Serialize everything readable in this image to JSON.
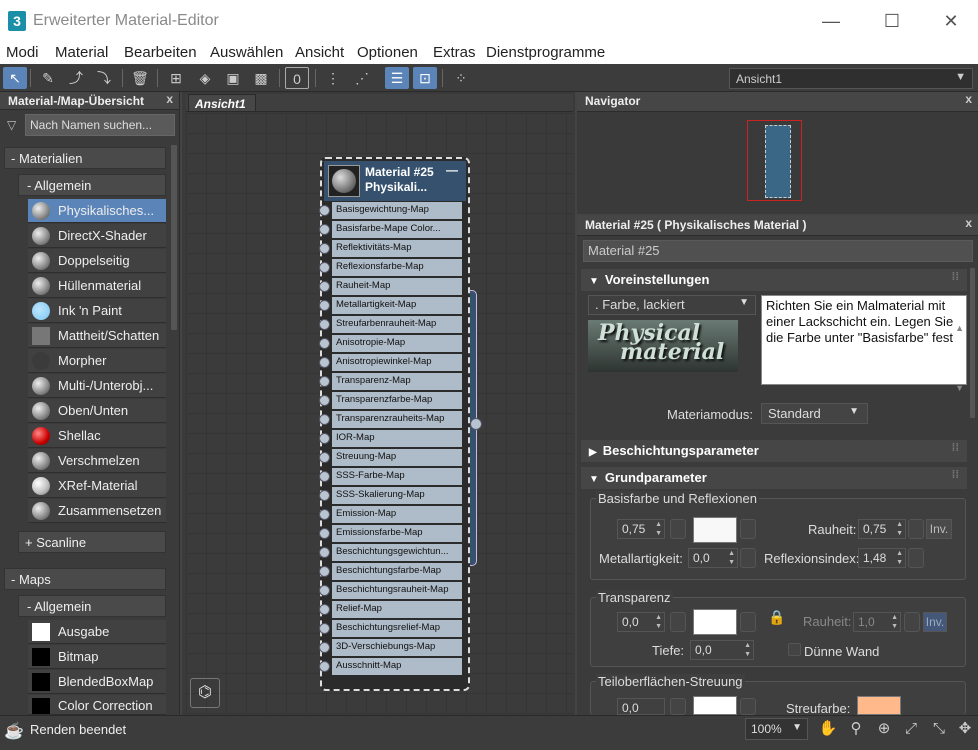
{
  "window": {
    "title": "Erweiterter Material-Editor",
    "app_icon": "3"
  },
  "menu": [
    "Modi",
    "Material",
    "Bearbeiten",
    "Auswählen",
    "Ansicht",
    "Optionen",
    "Extras",
    "Dienstprogramme"
  ],
  "toolbar": {
    "view_select": "Ansicht1",
    "zero_label": "0"
  },
  "left_panel": {
    "title": "Material-/Map-Übersicht",
    "search_placeholder": "Nach Namen suchen...",
    "materials_cat": "- Materialien",
    "general_sub": "- Allgemein",
    "items": [
      "Physikalisches...",
      "DirectX-Shader",
      "Doppelseitig",
      "Hüllenmaterial",
      "Ink 'n Paint",
      "Mattheit/Schatten",
      "Morpher",
      "Multi-/Unterobj...",
      "Oben/Unten",
      "Shellac",
      "Verschmelzen",
      "XRef-Material",
      "Zusammensetzen"
    ],
    "scanline": "+ Scanline",
    "maps_cat": "- Maps",
    "maps_general": "- Allgemein",
    "map_items": [
      "Ausgabe",
      "Bitmap",
      "BlendedBoxMap",
      "Color Correction"
    ]
  },
  "view_tab": "Ansicht1",
  "node": {
    "title_line1": "Material #25",
    "title_line2": "Physikali...",
    "slots": [
      "Basisgewichtung-Map",
      "Basisfarbe-Mape Color...",
      "Reflektivitäts-Map",
      "Reflexionsfarbe-Map",
      "Rauheit-Map",
      "Metallartigkeit-Map",
      "Streufarbenrauheit-Map",
      "Anisotropie-Map",
      "Anisotropiewinkel-Map",
      "Transparenz-Map",
      "Transparenzfarbe-Map",
      "Transparenzrauheits-Map",
      "IOR-Map",
      "Streuung-Map",
      "SSS-Farbe-Map",
      "SSS-Skalierung-Map",
      "Emission-Map",
      "Emissionsfarbe-Map",
      "Beschichtungsgewichtun...",
      "Beschichtungsfarbe-Map",
      "Beschichtungsrauheit-Map",
      "Relief-Map",
      "Beschichtungsrelief-Map",
      "3D-Verschiebungs-Map",
      "Ausschnitt-Map"
    ]
  },
  "navigator": {
    "title": "Navigator"
  },
  "params": {
    "title": "Material #25  ( Physikalisches Material )",
    "material_name": "Material #25",
    "voreinstellungen": "Voreinstellungen",
    "preset": ".  Farbe, lackiert",
    "logo_l1": "Physical",
    "logo_l2": "material",
    "description": "Richten Sie ein Malmaterial mit einer Lackschicht ein. Legen Sie die Farbe unter \"Basisfarbe\" fest",
    "mode_label": "Materiamodus:",
    "mode_value": "Standard",
    "beschichtung": "Beschichtungsparameter",
    "grund": "Grundparameter",
    "basis_group": "Basisfarbe und Reflexionen",
    "base_weight": "0,75",
    "rauheit_label": "Rauheit:",
    "rauheit_value": "0,75",
    "inv": "Inv.",
    "metall_label": "Metallartigkeit:",
    "metall_value": "0,0",
    "reflex_label": "Reflexionsindex:",
    "reflex_value": "1,48",
    "transp_group": "Transparenz",
    "transp_value": "0,0",
    "transp_rauheit_label": "Rauheit:",
    "transp_rauheit_value": "1,0",
    "inv2": "Inv.",
    "tiefe_label": "Tiefe:",
    "tiefe_value": "0,0",
    "thin_wall": "Dünne Wand",
    "sss_group": "Teiloberflächen-Streuung",
    "sss_value": "0,0",
    "streufarbe_label": "Streufarbe:"
  },
  "colors": {
    "accent": "#5b84b8",
    "node_header": "#35516e",
    "base_color": "#f8f8f8",
    "transp_color": "#ffffff",
    "scatter_color": "#ffb98a"
  },
  "status": {
    "text": "Renden beendet",
    "zoom": "100%"
  }
}
